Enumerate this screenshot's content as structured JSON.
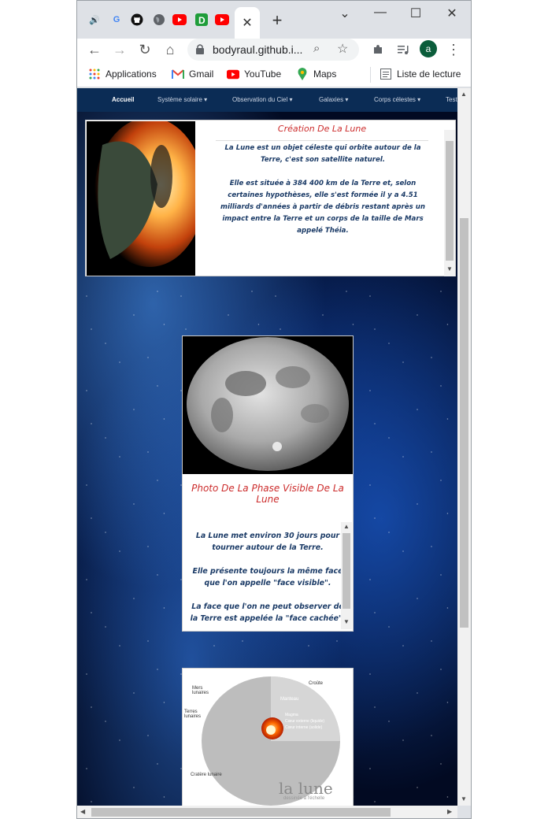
{
  "browser": {
    "tab_close_glyph": "✕",
    "new_tab_glyph": "+",
    "window_controls": [
      "⌄",
      "—",
      "☐",
      "✕"
    ],
    "url": "bodyraul.github.i...",
    "avatar_letter": "a",
    "bookmarks": [
      "Applications",
      "Gmail",
      "YouTube",
      "Maps"
    ],
    "reading_list": "Liste de lecture"
  },
  "site_nav": {
    "items": [
      "Accueil",
      "Système solaire ▾",
      "Observation du Ciel ▾",
      "Galaxies ▾",
      "Corps célestes ▾",
      "Test"
    ]
  },
  "creation_card": {
    "title": "Création De La Lune",
    "text": "La Lune est un objet céleste qui orbite autour de la Terre, c'est son satellite naturel.\n\nElle est située à 384 400 km de la Terre et, selon certaines hypothèses, elle s'est formée il y a 4.51 milliards d'années à partir de débris restant après un impact entre la Terre et un corps de la taille de Mars appelé Théia."
  },
  "phase_card": {
    "title": "Photo De La Phase Visible De La Lune",
    "text": "La Lune met environ 30 jours pour tourner autour de la Terre.\n\nElle présente toujours la même face que l'on appelle \"face visible\".\n\nLa face que l'on ne peut observer de la Terre est appelée la \"face cachée\"."
  },
  "diagram_card": {
    "labels": [
      "Croûte",
      "Mers lunaires",
      "Manteau",
      "Terres lunaires",
      "Magma",
      "Cœur externe (liquide)",
      "Cœur interne (solide)",
      "Cratère lunaire"
    ],
    "brand": "la lune",
    "brand_sub": "dessinée à l'échelle"
  },
  "colors": {
    "title_red": "#cc2c2c",
    "text_blue": "#1a3a66",
    "nav_bg": "#0b2c55"
  }
}
